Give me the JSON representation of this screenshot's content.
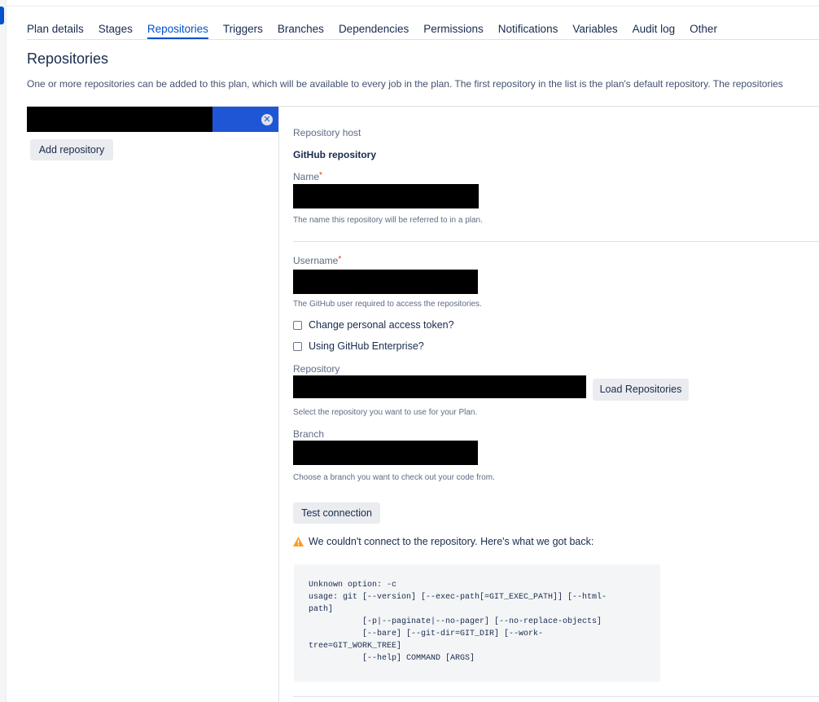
{
  "tabs": [
    {
      "label": "Plan details"
    },
    {
      "label": "Stages"
    },
    {
      "label": "Repositories"
    },
    {
      "label": "Triggers"
    },
    {
      "label": "Branches"
    },
    {
      "label": "Dependencies"
    },
    {
      "label": "Permissions"
    },
    {
      "label": "Notifications"
    },
    {
      "label": "Variables"
    },
    {
      "label": "Audit log"
    },
    {
      "label": "Other"
    }
  ],
  "active_tab": "Repositories",
  "page": {
    "title": "Repositories",
    "description": "One or more repositories can be added to this plan, which will be available to every job in the plan. The first repository in the list is the plan's default repository. The repositories"
  },
  "sidebar": {
    "add_repository_label": "Add repository",
    "remove_glyph": "✕"
  },
  "form": {
    "host_label": "Repository host",
    "host_value": "GitHub repository",
    "name_label": "Name",
    "required_mark": "*",
    "name_help": "The name this repository will be referred to in a plan.",
    "username_label": "Username",
    "username_help": "The GitHub user required to access the repositories.",
    "change_token_label": "Change personal access token?",
    "enterprise_label": "Using GitHub Enterprise?",
    "repository_label": "Repository",
    "load_repos_label": "Load Repositories",
    "repository_help": "Select the repository you want to use for your Plan.",
    "branch_label": "Branch",
    "branch_help": "Choose a branch you want to check out your code from.",
    "test_connection_label": "Test connection",
    "warning_text": "We couldn't connect to the repository. Here's what we got back:",
    "log": "Unknown option: -c\nusage: git [--version] [--exec-path[=GIT_EXEC_PATH]] [--html-\npath]\n           [-p|--paginate|--no-pager] [--no-replace-objects]\n           [--bare] [--git-dir=GIT_DIR] [--work-\ntree=GIT_WORK_TREE]\n           [--help] COMMAND [ARGS]"
  },
  "colors": {
    "accent": "#0052cc",
    "selected_repo": "#1f56d6",
    "warning": "#ff991f",
    "required": "#de350b"
  }
}
